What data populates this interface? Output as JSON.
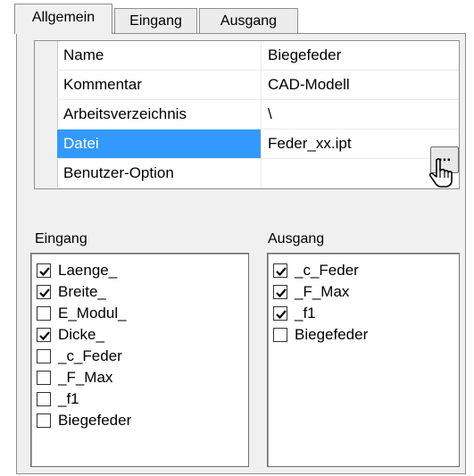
{
  "tabs": [
    {
      "label": "Allgemein"
    },
    {
      "label": "Eingang"
    },
    {
      "label": "Ausgang"
    }
  ],
  "properties": [
    {
      "name": "Name",
      "value": "Biegefeder"
    },
    {
      "name": "Kommentar",
      "value": "CAD-Modell"
    },
    {
      "name": "Arbeitsverzeichnis",
      "value": "\\"
    },
    {
      "name": "Datei",
      "value": "Feder_xx.ipt"
    },
    {
      "name": "Benutzer-Option",
      "value": ""
    }
  ],
  "browse_button": {
    "label": "..."
  },
  "eingang": {
    "title": "Eingang",
    "items": [
      {
        "label": "Laenge_",
        "checked": true
      },
      {
        "label": "Breite_",
        "checked": true
      },
      {
        "label": "E_Modul_",
        "checked": false
      },
      {
        "label": "Dicke_",
        "checked": true
      },
      {
        "label": "_c_Feder",
        "checked": false
      },
      {
        "label": "_F_Max",
        "checked": false
      },
      {
        "label": "_f1",
        "checked": false
      },
      {
        "label": "Biegefeder",
        "checked": false
      }
    ]
  },
  "ausgang": {
    "title": "Ausgang",
    "items": [
      {
        "label": "_c_Feder",
        "checked": true
      },
      {
        "label": "_F_Max",
        "checked": true
      },
      {
        "label": "_f1",
        "checked": true
      },
      {
        "label": "Biegefeder",
        "checked": false
      }
    ]
  },
  "colors": {
    "selection": "#3399ff",
    "panel": "#f0f0f0",
    "border": "#8e8f8f"
  }
}
